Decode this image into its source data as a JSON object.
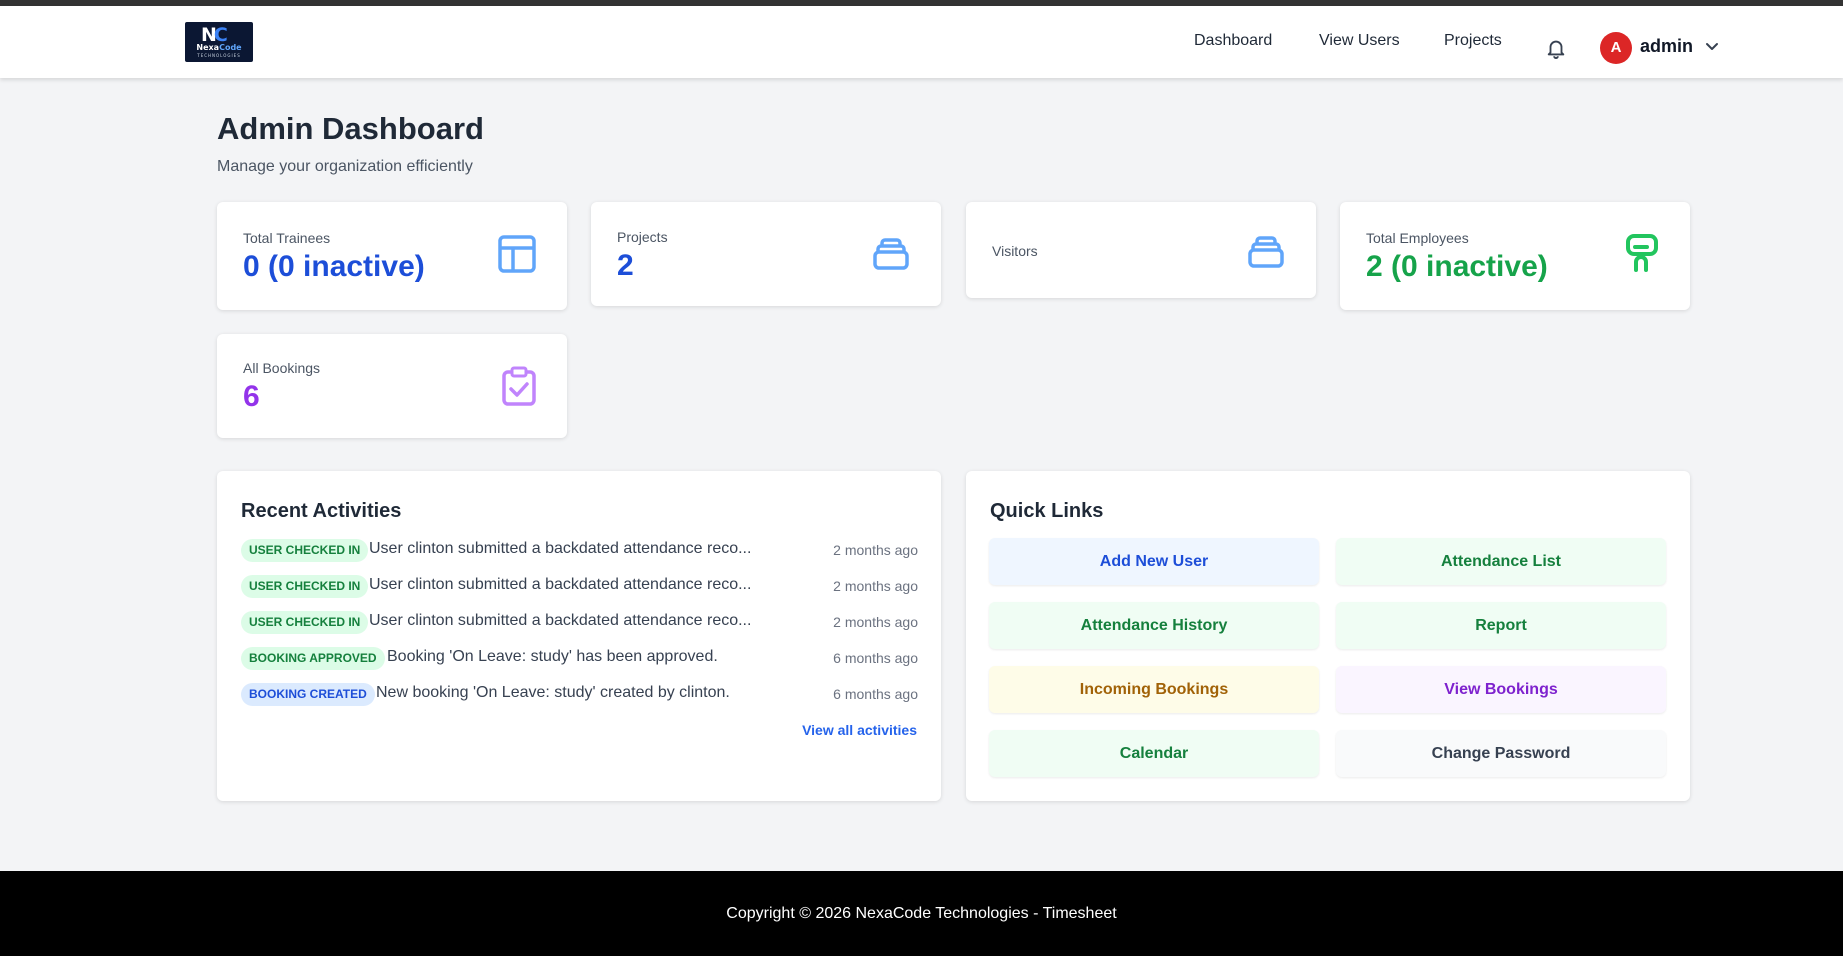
{
  "brand": {
    "logo_mark_left": "N",
    "logo_mark_right": "C",
    "logo_name_a": "Nexa",
    "logo_name_b": "Code",
    "logo_sub": "TECHNOLOGIES"
  },
  "nav": {
    "links": [
      "Dashboard",
      "View Users",
      "Projects"
    ],
    "user": {
      "initial": "A",
      "name": "admin"
    },
    "icons": {
      "notifications": "bell-icon",
      "menu": "chevron-down-icon"
    }
  },
  "header": {
    "title": "Admin Dashboard",
    "subtitle": "Manage your organization efficiently"
  },
  "stats": [
    {
      "label": "Total Trainees",
      "value": "0 (0 inactive)",
      "color": "#1d4ed8",
      "icon": "layout-icon",
      "icon_color": "#60a5fa"
    },
    {
      "label": "Projects",
      "value": "2",
      "color": "#1d4ed8",
      "icon": "stack-icon",
      "icon_color": "#60a5fa"
    },
    {
      "label": "Visitors",
      "value": "",
      "color": "#1d4ed8",
      "icon": "stack-icon",
      "icon_color": "#60a5fa"
    },
    {
      "label": "Total Employees",
      "value": "2 (0 inactive)",
      "color": "#16a34a",
      "icon": "employee-icon",
      "icon_color": "#22c55e"
    },
    {
      "label": "All Bookings",
      "value": "6",
      "color": "#9333ea",
      "icon": "clipboard-check-icon",
      "icon_color": "#c084fc"
    }
  ],
  "recent_activities": {
    "title": "Recent Activities",
    "items": [
      {
        "badge": "USER CHECKED IN",
        "text": "User clinton submitted a backdated attendance reco...",
        "time": "2 months ago"
      },
      {
        "badge": "USER CHECKED IN",
        "text": "User clinton submitted a backdated attendance reco...",
        "time": "2 months ago"
      },
      {
        "badge": "USER CHECKED IN",
        "text": "User clinton submitted a backdated attendance reco...",
        "time": "2 months ago"
      },
      {
        "badge": "BOOKING APPROVED",
        "text": "Booking 'On Leave: study' has been approved.",
        "time": "6 months ago"
      },
      {
        "badge": "BOOKING CREATED",
        "text": "New booking 'On Leave: study' created by clinton.",
        "time": "6 months ago"
      }
    ],
    "view_all": "View all activities"
  },
  "quick_links": {
    "title": "Quick Links",
    "items": [
      {
        "label": "Add New User",
        "bg": "#eff6ff",
        "color": "#1d4ed8"
      },
      {
        "label": "Attendance List",
        "bg": "#f0fdf4",
        "color": "#15803d"
      },
      {
        "label": "Attendance History",
        "bg": "#f0fdf4",
        "color": "#15803d"
      },
      {
        "label": "Report",
        "bg": "#f0fdf4",
        "color": "#15803d"
      },
      {
        "label": "Incoming Bookings",
        "bg": "#fefce8",
        "color": "#a16207"
      },
      {
        "label": "View Bookings",
        "bg": "#faf5ff",
        "color": "#7e22ce"
      },
      {
        "label": "Calendar",
        "bg": "#f0fdf4",
        "color": "#15803d"
      },
      {
        "label": "Change Password",
        "bg": "#f9fafb",
        "color": "#374151"
      }
    ]
  },
  "footer": {
    "text": "Copyright © 2026 NexaCode Technologies - Timesheet"
  }
}
